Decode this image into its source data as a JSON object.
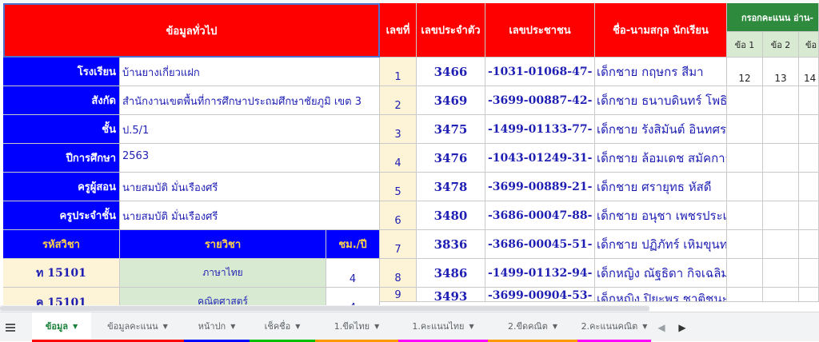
{
  "general": {
    "header": "ข้อมูลทั่วไป",
    "rows": [
      {
        "label": "โรงเรียน",
        "value": "บ้านยางเกี่ยวแฝก"
      },
      {
        "label": "สังกัด",
        "value": "สำนักงานเขตพื้นที่การศึกษาประถมศึกษาชัยภูมิ เขต 3"
      },
      {
        "label": "ชั้น",
        "value": "ป.5/1"
      },
      {
        "label": "ปีการศึกษา",
        "value": "2563"
      },
      {
        "label": "ครูผู้สอน",
        "value": "นายสมบัติ  มั่นเรืองศรี"
      },
      {
        "label": "ครูประจำชั้น",
        "value": "นายสมบัติ  มั่นเรืองศรี"
      }
    ]
  },
  "subjects": {
    "headers": {
      "code": "รหัสวิชา",
      "name": "รายวิชา",
      "hours": "ชม./ปี"
    },
    "rows": [
      {
        "code": "ท 15101",
        "name": "ภาษาไทย",
        "hours": "4"
      },
      {
        "code": "ค 15101",
        "name": "คณิตศาสตร์",
        "hours": "4"
      }
    ]
  },
  "students": {
    "headers": {
      "no": "เลขที่",
      "student_id": "เลขประจำตัว",
      "citizen_id": "เลขประชาชน",
      "name": "ชื่อ-นามสกุล นักเรียน"
    },
    "rows": [
      {
        "no": "1",
        "student_id": "3466",
        "citizen_id": "-1031-01068-47-",
        "name": "เด็กชาย กฤษกร สีมา"
      },
      {
        "no": "2",
        "student_id": "3469",
        "citizen_id": "-3699-00887-42-",
        "name": "เด็กชาย ธนาบดินทร์ โพธิ"
      },
      {
        "no": "3",
        "student_id": "3475",
        "citizen_id": "-1499-01133-77-",
        "name": "เด็กชาย รังสิมันต์ อินทศร"
      },
      {
        "no": "4",
        "student_id": "3476",
        "citizen_id": "-1043-01249-31-",
        "name": "เด็กชาย ล้อมเดช สมัคการ"
      },
      {
        "no": "5",
        "student_id": "3478",
        "citizen_id": "-3699-00889-21-",
        "name": "เด็กชาย ศรายุทธ หัสดี"
      },
      {
        "no": "6",
        "student_id": "3480",
        "citizen_id": "-3686-00047-88-",
        "name": "เด็กชาย อนุชา เพชรประเสริฐ"
      },
      {
        "no": "7",
        "student_id": "3836",
        "citizen_id": "-3686-00045-51-",
        "name": "เด็กชาย ปฏิภัทร์ เหิมขุนทด"
      },
      {
        "no": "8",
        "student_id": "3486",
        "citizen_id": "-1499-01132-94-",
        "name": "เด็กหญิง ณัฐธิดา กิจเฉลิม"
      },
      {
        "no": "9",
        "student_id": "3493",
        "citizen_id": "-3699-00904-53-",
        "name": "เด็กหญิง ปิยะพร ชาติชนะ"
      }
    ]
  },
  "scores": {
    "group_header": "กรอกคะแนน อ่าน-",
    "sub_headers": [
      "ข้อ 1",
      "ข้อ 2",
      "ข้อ"
    ],
    "row1": [
      "12",
      "13",
      "14"
    ]
  },
  "tabs": [
    "ข้อมูล",
    "ข้อมูลคะแนน",
    "หน้าปก",
    "เช็คชื่อ",
    "1.ขีดไทย",
    "1.คะแนนไทย",
    "2.ขีดคณิต",
    "2.คะแนนคณิต"
  ],
  "tab_colors": [
    "#ff0000",
    "#ff0000",
    "#0000ff",
    "#00c000",
    "#ff9900",
    "#ff00ff",
    "#ff9900",
    "#ff00ff"
  ],
  "tab_icons": {
    "menu": "menu-icon",
    "prev": "chevron-left-icon",
    "next": "chevron-right-icon"
  }
}
